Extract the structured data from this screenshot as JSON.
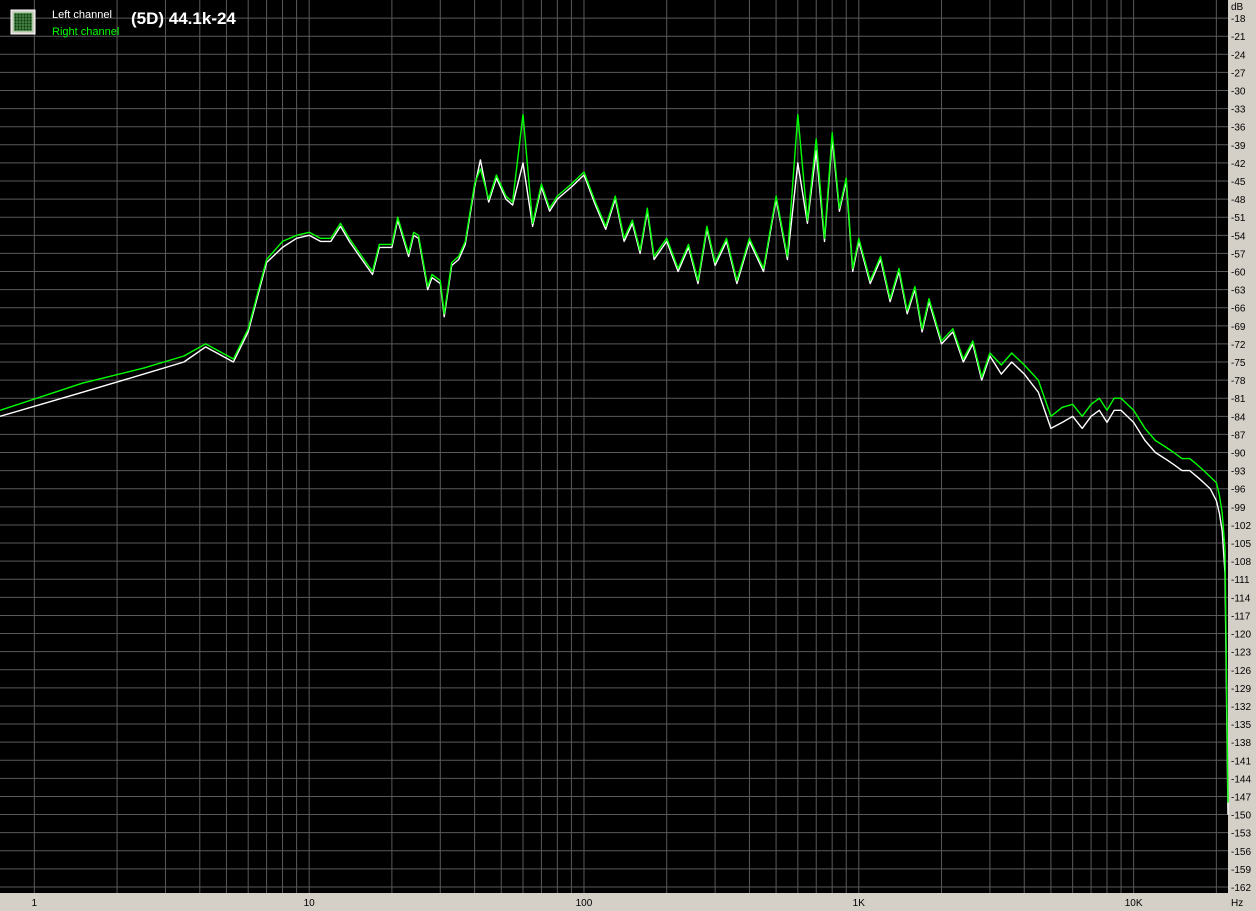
{
  "legend": {
    "left_label": "Left channel",
    "right_label": "Right channel",
    "icon": "spectrum-grid-icon"
  },
  "colors": {
    "background": "#000000",
    "grid": "#5a5a5a",
    "left_channel": "#ffffff",
    "right_channel": "#00ff00",
    "axis_panel": "#d4d0c8",
    "axis_text": "#000000"
  },
  "chart_data": {
    "type": "line",
    "title": "(5D) 44.1k-24",
    "xlabel": "Hz",
    "ylabel": "dB",
    "x_scale": "log",
    "xlim": [
      0.75,
      22050
    ],
    "ylim": [
      -163,
      -15
    ],
    "grid": true,
    "legend_position": "top-left",
    "x_tick_labels": [
      {
        "value": 1,
        "label": "1"
      },
      {
        "value": 10,
        "label": "10"
      },
      {
        "value": 100,
        "label": "100"
      },
      {
        "value": 1000,
        "label": "1K"
      },
      {
        "value": 10000,
        "label": "10K"
      }
    ],
    "y_ticks": [
      -18,
      -21,
      -24,
      -27,
      -30,
      -33,
      -36,
      -39,
      -42,
      -45,
      -48,
      -51,
      -54,
      -57,
      -60,
      -63,
      -66,
      -69,
      -72,
      -75,
      -78,
      -81,
      -84,
      -87,
      -90,
      -93,
      -96,
      -99,
      -102,
      -105,
      -108,
      -111,
      -114,
      -117,
      -120,
      -123,
      -126,
      -129,
      -132,
      -135,
      -138,
      -141,
      -144,
      -147,
      -150,
      -153,
      -156,
      -159,
      -162
    ],
    "series": [
      {
        "name": "Left channel",
        "x": [
          0.75,
          1.5,
          2.5,
          3.5,
          4.2,
          5.3,
          6,
          7,
          8,
          9,
          10,
          11,
          12,
          13,
          14,
          15,
          17,
          18,
          20,
          21,
          23,
          24,
          25,
          27,
          28,
          30,
          31,
          33,
          35,
          37,
          40,
          42,
          45,
          48,
          52,
          55,
          60,
          65,
          70,
          75,
          80,
          90,
          100,
          110,
          120,
          130,
          140,
          150,
          160,
          170,
          180,
          200,
          220,
          240,
          260,
          280,
          300,
          330,
          360,
          400,
          450,
          500,
          550,
          600,
          650,
          700,
          750,
          800,
          850,
          900,
          950,
          1000,
          1100,
          1200,
          1300,
          1400,
          1500,
          1600,
          1700,
          1800,
          2000,
          2200,
          2400,
          2600,
          2800,
          3000,
          3300,
          3600,
          4000,
          4500,
          5000,
          5500,
          6000,
          6500,
          7000,
          7500,
          8000,
          8500,
          9000,
          10000,
          11000,
          12000,
          13000,
          14000,
          15000,
          16000,
          17000,
          18000,
          19000,
          20000,
          20500,
          21000,
          21500,
          22050
        ],
        "y": [
          -84,
          -80,
          -77,
          -75,
          -72.5,
          -75,
          -70,
          -58.5,
          -56,
          -54.5,
          -54,
          -55,
          -55,
          -52.5,
          -55,
          -57,
          -60.5,
          -56,
          -56,
          -51.5,
          -57.5,
          -54,
          -54.5,
          -63,
          -61,
          -62,
          -67.5,
          -59,
          -58,
          -55.5,
          -46,
          -41.5,
          -48.5,
          -44.5,
          -48,
          -49,
          -42,
          -52.5,
          -46,
          -50,
          -48,
          -46,
          -44,
          -49,
          -53,
          -48,
          -55,
          -52,
          -57,
          -50,
          -58,
          -55,
          -60,
          -56,
          -62,
          -53,
          -59,
          -55,
          -62,
          -55,
          -60,
          -48,
          -58,
          -42,
          -52,
          -40,
          -55,
          -38,
          -50,
          -45,
          -60,
          -55,
          -62,
          -58,
          -65,
          -60,
          -67,
          -63,
          -70,
          -65,
          -72,
          -70,
          -75,
          -72,
          -78,
          -74,
          -77,
          -75,
          -77,
          -80,
          -86,
          -85,
          -84,
          -86,
          -84,
          -83,
          -85,
          -83,
          -83,
          -85,
          -88,
          -90,
          -91,
          -92,
          -93,
          -93,
          -94,
          -95,
          -96,
          -98,
          -100,
          -103,
          -110,
          -150
        ]
      },
      {
        "name": "Right channel",
        "x": [
          0.75,
          1.5,
          2.5,
          3.5,
          4.2,
          5.3,
          6,
          7,
          8,
          9,
          10,
          11,
          12,
          13,
          14,
          15,
          17,
          18,
          20,
          21,
          23,
          24,
          25,
          27,
          28,
          30,
          31,
          33,
          35,
          37,
          40,
          42,
          45,
          48,
          52,
          55,
          60,
          65,
          70,
          75,
          80,
          90,
          100,
          110,
          120,
          130,
          140,
          150,
          160,
          170,
          180,
          200,
          220,
          240,
          260,
          280,
          300,
          330,
          360,
          400,
          450,
          500,
          550,
          600,
          650,
          700,
          750,
          800,
          850,
          900,
          950,
          1000,
          1100,
          1200,
          1300,
          1400,
          1500,
          1600,
          1700,
          1800,
          2000,
          2200,
          2400,
          2600,
          2800,
          3000,
          3300,
          3600,
          4000,
          4500,
          5000,
          5500,
          6000,
          6500,
          7000,
          7500,
          8000,
          8500,
          9000,
          10000,
          11000,
          12000,
          13000,
          14000,
          15000,
          16000,
          17000,
          18000,
          19000,
          20000,
          20500,
          21000,
          21500,
          22050
        ],
        "y": [
          -83,
          -78.5,
          -76,
          -74,
          -72,
          -74.5,
          -69.5,
          -58,
          -55,
          -54,
          -53.5,
          -54.5,
          -54.5,
          -52,
          -54.5,
          -56.5,
          -60,
          -55.5,
          -55.5,
          -51,
          -57,
          -53.5,
          -54,
          -62.5,
          -60.5,
          -61.5,
          -67,
          -58.5,
          -57.5,
          -55,
          -45.5,
          -43,
          -48,
          -44,
          -47.5,
          -48.5,
          -34,
          -52,
          -45.5,
          -49.5,
          -47.5,
          -45.5,
          -43.5,
          -48.5,
          -52.5,
          -47.5,
          -54.5,
          -51.5,
          -56.5,
          -49.5,
          -57.5,
          -54.5,
          -59.5,
          -55.5,
          -61.5,
          -52.5,
          -58.5,
          -54.5,
          -61.5,
          -54.5,
          -59.5,
          -47.5,
          -57.5,
          -34,
          -51.5,
          -38,
          -54.5,
          -37,
          -49.5,
          -44.5,
          -59.5,
          -54.5,
          -61.5,
          -57.5,
          -64.5,
          -59.5,
          -66.5,
          -62.5,
          -69.5,
          -64.5,
          -71.5,
          -69.5,
          -74.5,
          -71.5,
          -77.5,
          -73.5,
          -75.5,
          -73.5,
          -75.5,
          -78,
          -84,
          -82.5,
          -82,
          -84,
          -82,
          -81,
          -83,
          -81,
          -81,
          -83,
          -86,
          -88,
          -89,
          -90,
          -91,
          -91,
          -92,
          -93,
          -94,
          -95,
          -97,
          -100,
          -106,
          -148
        ]
      }
    ]
  }
}
